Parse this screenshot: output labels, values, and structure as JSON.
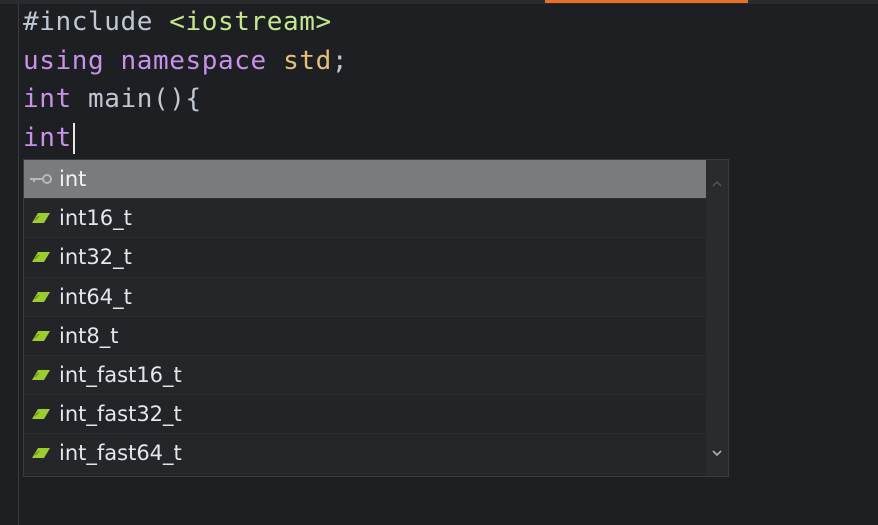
{
  "editor": {
    "lines": [
      {
        "segments": [
          {
            "text": "#include ",
            "cls": "pre"
          },
          {
            "text": "<iostream>",
            "cls": "inc"
          }
        ]
      },
      {
        "segments": [
          {
            "text": "using ",
            "cls": "kw"
          },
          {
            "text": "namespace ",
            "cls": "kw"
          },
          {
            "text": "std",
            "cls": "ns"
          },
          {
            "text": ";",
            "cls": "pre"
          }
        ]
      },
      {
        "segments": [
          {
            "text": "int ",
            "cls": "ty"
          },
          {
            "text": "main(){",
            "cls": "pre"
          }
        ]
      },
      {
        "segments": [
          {
            "text": "int",
            "cls": "ty"
          }
        ],
        "caret": true
      }
    ]
  },
  "completion": {
    "items": [
      {
        "label": "int",
        "icon": "keyword-icon",
        "selected": true
      },
      {
        "label": "int16_t",
        "icon": "type-icon"
      },
      {
        "label": "int32_t",
        "icon": "type-icon"
      },
      {
        "label": "int64_t",
        "icon": "type-icon"
      },
      {
        "label": "int8_t",
        "icon": "type-icon"
      },
      {
        "label": "int_fast16_t",
        "icon": "type-icon"
      },
      {
        "label": "int_fast32_t",
        "icon": "type-icon"
      },
      {
        "label": "int_fast64_t",
        "icon": "type-icon"
      }
    ]
  },
  "colors": {
    "background": "#1e1f22",
    "tab_accent": "#e8712a",
    "selected_item": "#7a7b7f",
    "type_icon": "#9ccc2e",
    "keyword_icon": "#b8b8b8"
  }
}
